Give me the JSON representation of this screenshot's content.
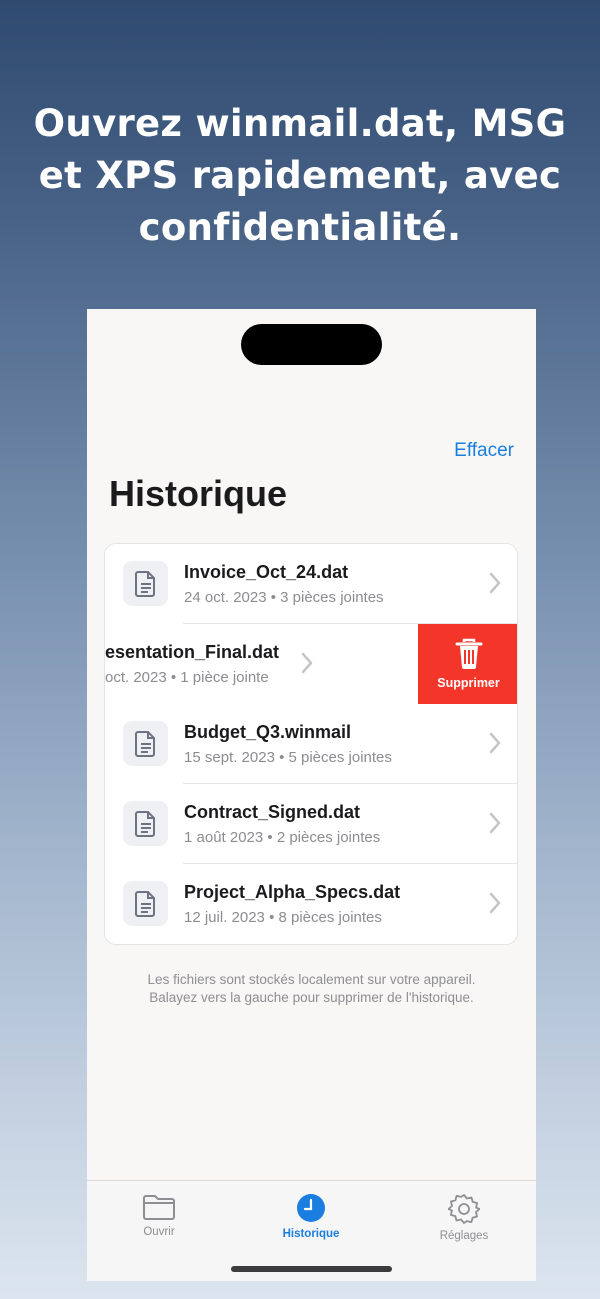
{
  "headline": "Ouvrez winmail.dat, MSG et XPS rapidement, avec confidentialité.",
  "nav": {
    "action_label": "Effacer"
  },
  "page_title": "Historique",
  "files": [
    {
      "name": "Invoice_Oct_24.dat",
      "meta": "24 oct. 2023 • 3 pièces jointes"
    },
    {
      "name": "esentation_Final.dat",
      "meta": "oct. 2023 • 1 pièce jointe"
    },
    {
      "name": "Budget_Q3.winmail",
      "meta": "15 sept. 2023 • 5 pièces jointes"
    },
    {
      "name": "Contract_Signed.dat",
      "meta": "1 août 2023 • 2 pièces jointes"
    },
    {
      "name": "Project_Alpha_Specs.dat",
      "meta": "12 juil. 2023 • 8 pièces jointes"
    }
  ],
  "delete_label": "Supprimer",
  "footnote_line1": "Les fichiers sont stockés localement sur votre appareil.",
  "footnote_line2": "Balayez vers la gauche pour supprimer de l'historique.",
  "tabs": [
    {
      "label": "Ouvrir",
      "icon": "folder-icon",
      "active": false
    },
    {
      "label": "Historique",
      "icon": "clock-icon",
      "active": true
    },
    {
      "label": "Réglages",
      "icon": "gear-icon",
      "active": false
    }
  ],
  "colors": {
    "accent": "#1a7de0",
    "delete": "#f3352a"
  }
}
